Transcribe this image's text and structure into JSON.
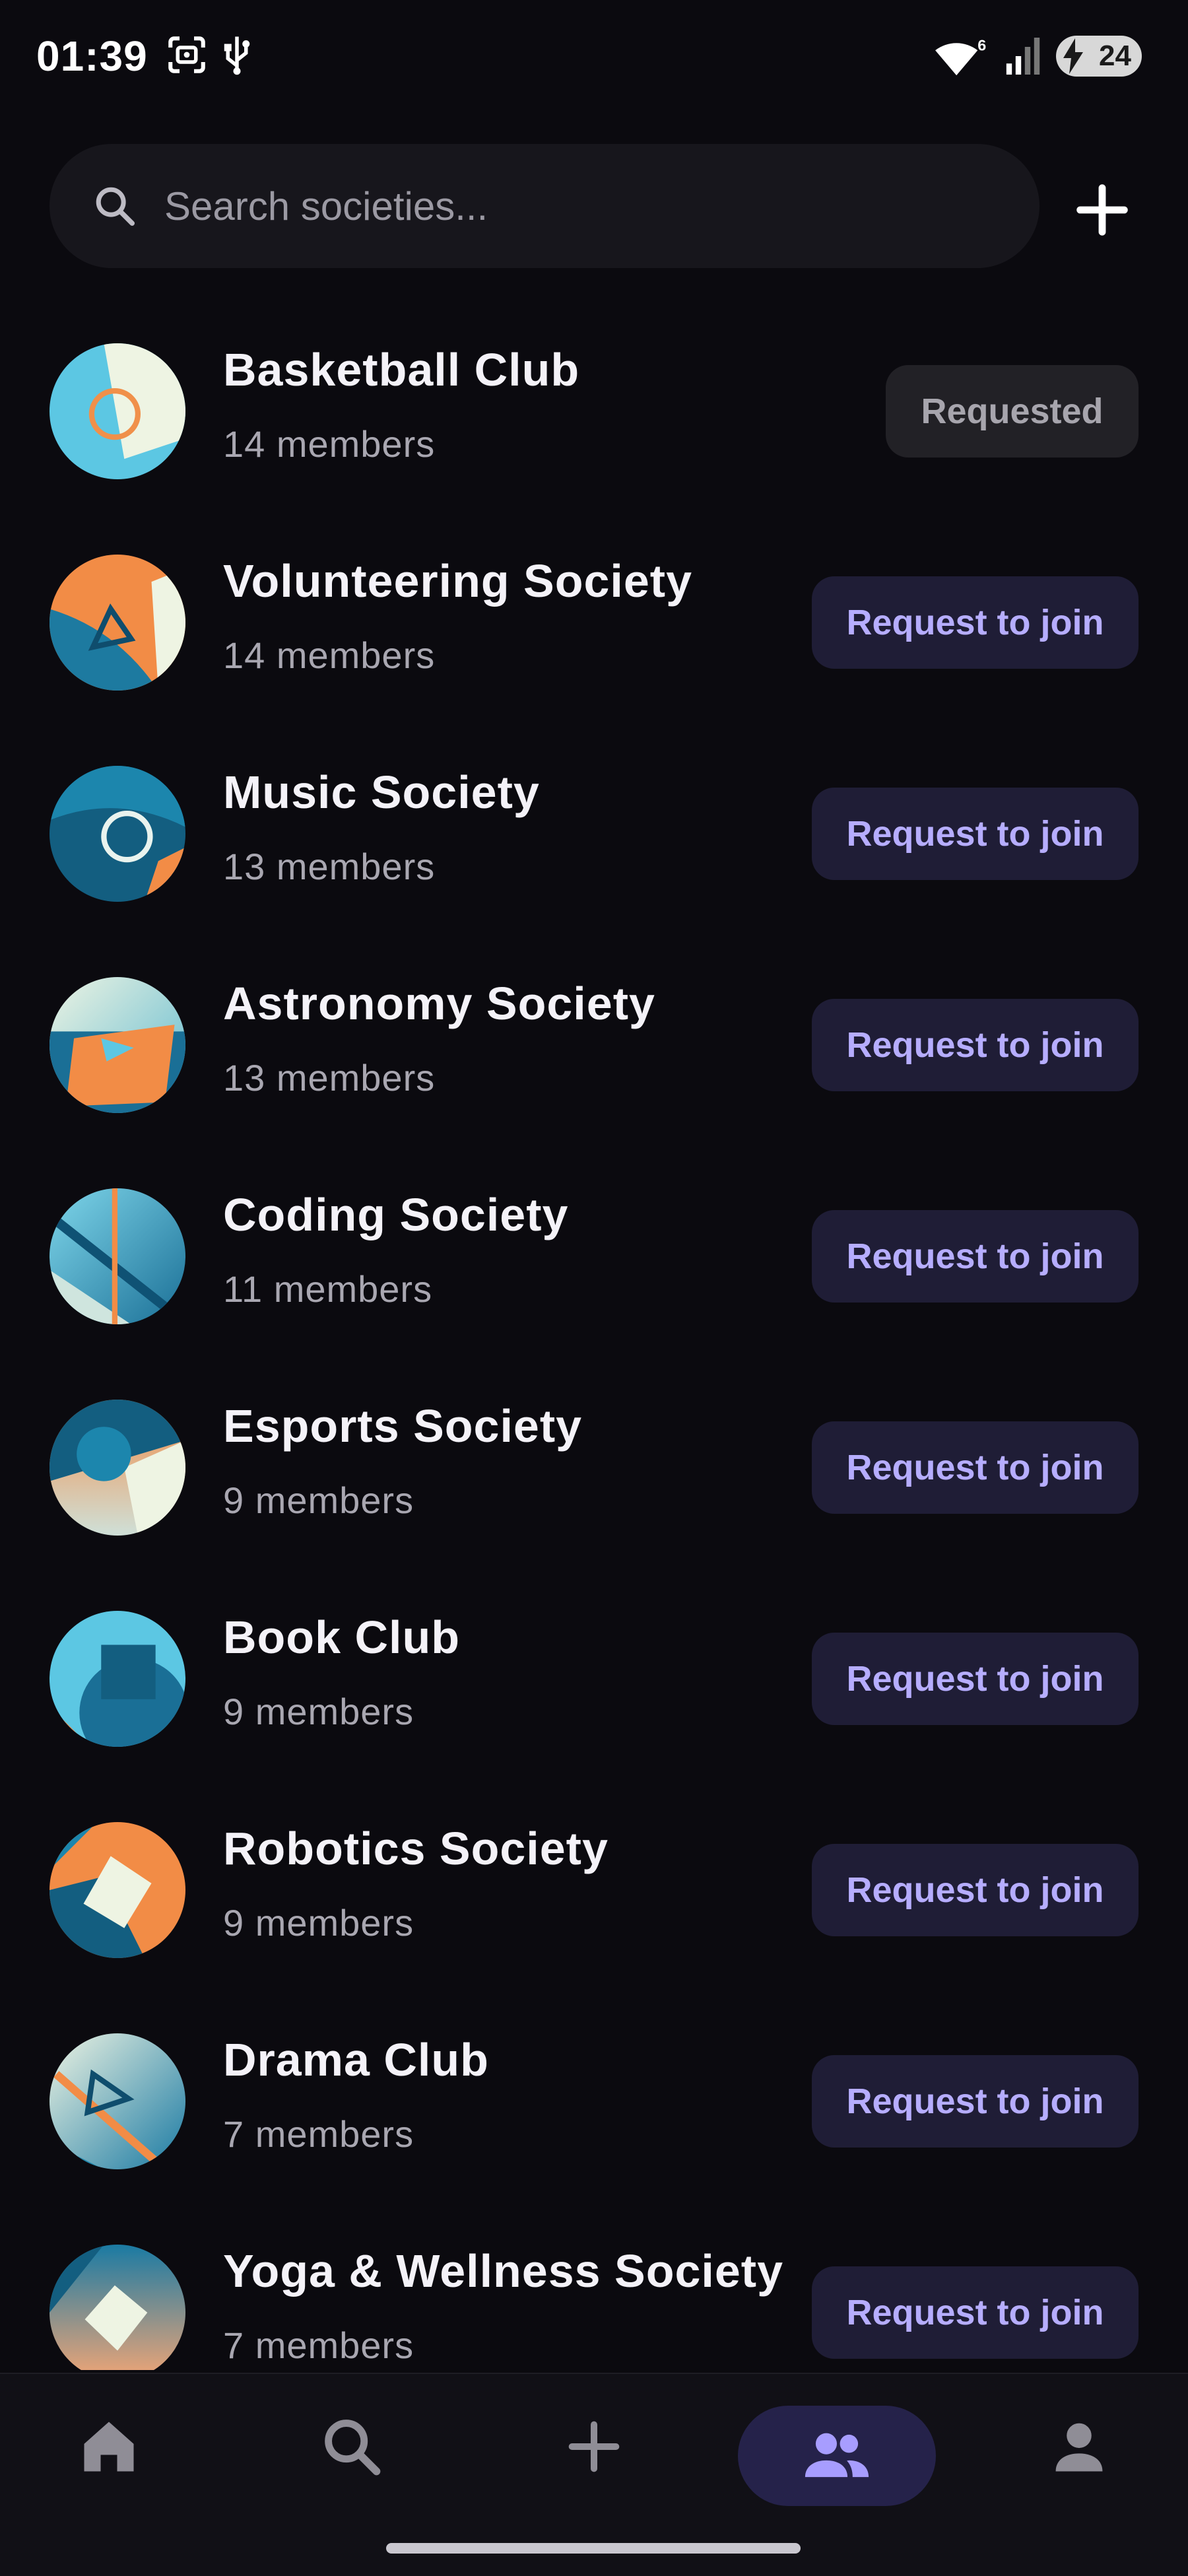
{
  "status_bar": {
    "time": "01:39",
    "battery_level": "24",
    "wifi_badge": "6",
    "icons": [
      "screenshot-icon",
      "usb-icon",
      "wifi-icon",
      "signal-icon",
      "battery-charging-icon"
    ]
  },
  "search": {
    "placeholder": "Search societies..."
  },
  "colors": {
    "background": "#0b0a0f",
    "accent": "#b6adff",
    "join_button_bg": "#1f1d36",
    "requested_button_bg": "#222126"
  },
  "societies": [
    {
      "name": "Basketball Club",
      "members": "14 members",
      "action": "Requested"
    },
    {
      "name": "Volunteering Society",
      "members": "14 members",
      "action": "Request to join"
    },
    {
      "name": "Music Society",
      "members": "13 members",
      "action": "Request to join"
    },
    {
      "name": "Astronomy Society",
      "members": "13 members",
      "action": "Request to join"
    },
    {
      "name": "Coding Society",
      "members": "11 members",
      "action": "Request to join"
    },
    {
      "name": "Esports Society",
      "members": "9 members",
      "action": "Request to join"
    },
    {
      "name": "Book Club",
      "members": "9 members",
      "action": "Request to join"
    },
    {
      "name": "Robotics Society",
      "members": "9 members",
      "action": "Request to join"
    },
    {
      "name": "Drama Club",
      "members": "7 members",
      "action": "Request to join"
    },
    {
      "name": "Yoga & Wellness Society",
      "members": "7 members",
      "action": "Request to join"
    }
  ],
  "bottom_nav": {
    "items": [
      "home-icon",
      "search-icon",
      "add-icon",
      "groups-icon",
      "profile-icon"
    ],
    "active": "groups-icon"
  }
}
